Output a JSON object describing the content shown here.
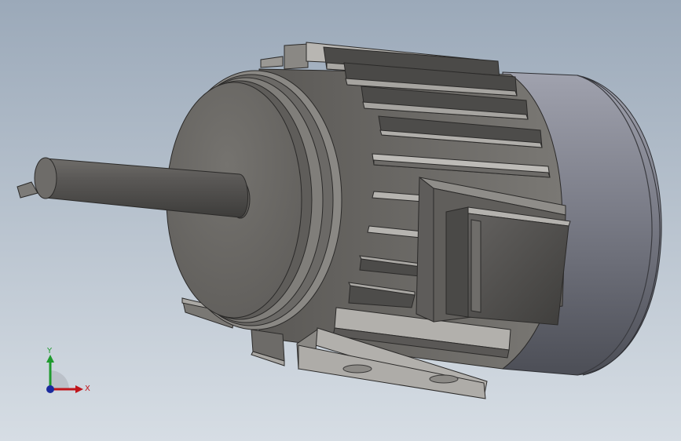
{
  "triad": {
    "x_label": "X",
    "y_label": "Y",
    "x_color": "#c0151b",
    "y_color": "#1f9a2e",
    "z_color": "#1b2a9e"
  },
  "colors": {
    "background_top": "#9ba9b9",
    "background_bottom": "#d6dde4",
    "body_dark": "#4a4846",
    "body_mid": "#6d6b68",
    "body_light": "#8a8884",
    "fin_light": "#b6b4b0",
    "fan_cover_light": "#9a9ca8",
    "fan_cover_dark": "#50525a"
  }
}
